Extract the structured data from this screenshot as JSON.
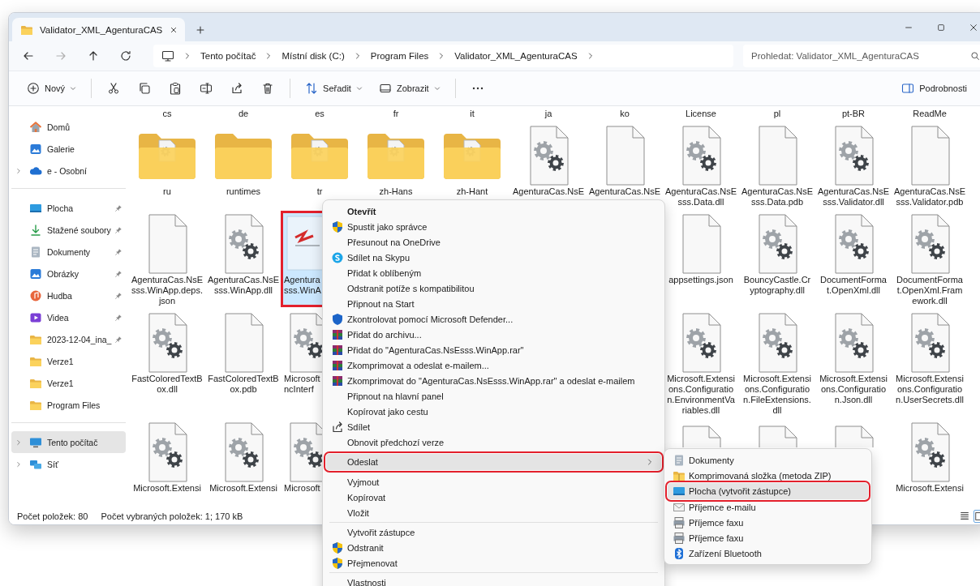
{
  "window": {
    "title": "Validator_XML_AgenturaCAS"
  },
  "nav_buttons": [
    {
      "kind": "back",
      "disabled": false
    },
    {
      "kind": "forward",
      "disabled": true
    },
    {
      "kind": "up",
      "disabled": false
    },
    {
      "kind": "refresh",
      "disabled": false
    }
  ],
  "breadcrumb": [
    "Tento počítač",
    "Místní disk (C:)",
    "Program Files",
    "Validator_XML_AgenturaCAS"
  ],
  "search": {
    "placeholder": "Prohledat: Validator_XML_AgenturaCAS"
  },
  "toolbar": [
    {
      "kind": "new",
      "label": "Nový"
    },
    {
      "kind": "separator"
    },
    {
      "kind": "cut"
    },
    {
      "kind": "copy"
    },
    {
      "kind": "paste"
    },
    {
      "kind": "rename"
    },
    {
      "kind": "share"
    },
    {
      "kind": "delete"
    },
    {
      "kind": "separator"
    },
    {
      "kind": "sort",
      "label": "Seřadit"
    },
    {
      "kind": "view",
      "label": "Zobrazit"
    },
    {
      "kind": "separator"
    },
    {
      "kind": "more"
    }
  ],
  "details_button": {
    "label": "Podrobnosti"
  },
  "sidebar": {
    "groups": [
      {
        "items": [
          {
            "kind": "home",
            "label": "Domů",
            "pinned": false,
            "expandable": false,
            "selected": false
          },
          {
            "kind": "gallery",
            "label": "Galerie",
            "pinned": false,
            "expandable": false,
            "selected": false
          },
          {
            "kind": "cloud",
            "label": "e - Osobní",
            "pinned": false,
            "expandable": true,
            "selected": false
          }
        ]
      },
      {
        "items": [
          {
            "kind": "desktop",
            "label": "Plocha",
            "pinned": true,
            "expandable": false,
            "selected": false
          },
          {
            "kind": "download",
            "label": "Stažené soubory",
            "pinned": true,
            "expandable": false,
            "selected": false
          },
          {
            "kind": "documents",
            "label": "Dokumenty",
            "pinned": true,
            "expandable": false,
            "selected": false
          },
          {
            "kind": "pictures",
            "label": "Obrázky",
            "pinned": true,
            "expandable": false,
            "selected": false
          },
          {
            "kind": "music",
            "label": "Hudba",
            "pinned": true,
            "expandable": false,
            "selected": false
          },
          {
            "kind": "videos",
            "label": "Videa",
            "pinned": true,
            "expandable": false,
            "selected": false
          },
          {
            "kind": "folder",
            "label": "2023-12-04_ina_",
            "pinned": true,
            "expandable": false,
            "selected": false
          },
          {
            "kind": "folder",
            "label": "Verze1",
            "pinned": false,
            "expandable": false,
            "selected": false
          },
          {
            "kind": "folder",
            "label": "Verze1",
            "pinned": false,
            "expandable": false,
            "selected": false
          },
          {
            "kind": "folder",
            "label": "Program Files",
            "pinned": false,
            "expandable": false,
            "selected": false
          }
        ]
      },
      {
        "items": [
          {
            "kind": "pc",
            "label": "Tento počítač",
            "pinned": false,
            "expandable": true,
            "selected": true
          },
          {
            "kind": "network",
            "label": "Síť",
            "pinned": false,
            "expandable": true,
            "selected": false
          }
        ]
      }
    ]
  },
  "files": {
    "rows": [
      {
        "items": [
          {
            "kind": "name",
            "label": "cs",
            "selected": false,
            "highlighted": false,
            "cut": false
          },
          {
            "kind": "name",
            "label": "de",
            "selected": false,
            "highlighted": false,
            "cut": false
          },
          {
            "kind": "name",
            "label": "es",
            "selected": false,
            "highlighted": false,
            "cut": false
          },
          {
            "kind": "name",
            "label": "fr",
            "selected": false,
            "highlighted": false,
            "cut": false
          },
          {
            "kind": "name",
            "label": "it",
            "selected": false,
            "highlighted": false,
            "cut": false
          },
          {
            "kind": "name",
            "label": "ja",
            "selected": false,
            "highlighted": false,
            "cut": false
          },
          {
            "kind": "name",
            "label": "ko",
            "selected": false,
            "highlighted": false,
            "cut": false
          },
          {
            "kind": "name",
            "label": "License",
            "selected": false,
            "highlighted": false,
            "cut": false
          },
          {
            "kind": "name",
            "label": "pl",
            "selected": false,
            "highlighted": false,
            "cut": false
          },
          {
            "kind": "name",
            "label": "pt-BR",
            "selected": false,
            "highlighted": false,
            "cut": false
          },
          {
            "kind": "name",
            "label": "ReadMe",
            "selected": false,
            "highlighted": false,
            "cut": false
          }
        ]
      },
      {
        "items": [
          {
            "kind": "folder-doc",
            "label": "ru",
            "selected": false,
            "highlighted": false,
            "cut": false
          },
          {
            "kind": "folder",
            "label": "runtimes",
            "selected": false,
            "highlighted": false,
            "cut": false
          },
          {
            "kind": "folder-doc",
            "label": "tr",
            "selected": false,
            "highlighted": false,
            "cut": false
          },
          {
            "kind": "folder-doc",
            "label": "zh-Hans",
            "selected": false,
            "highlighted": false,
            "cut": false
          },
          {
            "kind": "folder-doc",
            "label": "zh-Hant",
            "selected": false,
            "highlighted": false,
            "cut": false
          },
          {
            "kind": "gear-file",
            "label": "AgenturaCas.NsE",
            "selected": false,
            "highlighted": false,
            "cut": false
          },
          {
            "kind": "file",
            "label": "AgenturaCas.NsE",
            "selected": false,
            "highlighted": false,
            "cut": false
          },
          {
            "kind": "gear-file",
            "label": "AgenturaCas.NsE\nsss.Data.dll",
            "selected": false,
            "highlighted": false,
            "cut": false
          },
          {
            "kind": "file",
            "label": "AgenturaCas.NsE\nsss.Data.pdb",
            "selected": false,
            "highlighted": false,
            "cut": false
          },
          {
            "kind": "gear-file",
            "label": "AgenturaCas.NsE\nsss.Validator.dll",
            "selected": false,
            "highlighted": false,
            "cut": false
          },
          {
            "kind": "file",
            "label": "AgenturaCas.NsE\nsss.Validator.pdb",
            "selected": false,
            "highlighted": false,
            "cut": false
          }
        ]
      },
      {
        "items": [
          {
            "kind": "file",
            "label": "AgenturaCas.NsE\nsss.WinApp.deps.\njson",
            "selected": false,
            "highlighted": false,
            "cut": false
          },
          {
            "kind": "gear-file",
            "label": "AgenturaCas.NsE\nsss.WinApp.dll",
            "selected": false,
            "highlighted": false,
            "cut": false
          },
          {
            "kind": "app",
            "label": "Agentura\nsss.WinA",
            "selected": true,
            "highlighted": true,
            "cut": true
          },
          {
            "kind": "hidden"
          },
          {
            "kind": "hidden"
          },
          {
            "kind": "hidden"
          },
          {
            "kind": "hidden"
          },
          {
            "kind": "file",
            "label": "appsettings.json",
            "selected": false,
            "highlighted": false,
            "cut": false
          },
          {
            "kind": "gear-file",
            "label": "BouncyCastle.Cr\nyptography.dll",
            "selected": false,
            "highlighted": false,
            "cut": false
          },
          {
            "kind": "gear-file",
            "label": "DocumentForma\nt.OpenXml.dll",
            "selected": false,
            "highlighted": false,
            "cut": false
          },
          {
            "kind": "gear-file",
            "label": "DocumentForma\nt.OpenXml.Fram\nework.dll",
            "selected": false,
            "highlighted": false,
            "cut": false
          }
        ]
      },
      {
        "items": [
          {
            "kind": "gear-file",
            "label": "FastColoredTextB\nox.dll",
            "selected": false,
            "highlighted": false,
            "cut": false
          },
          {
            "kind": "file",
            "label": "FastColoredTextB\nox.pdb",
            "selected": false,
            "highlighted": false,
            "cut": false
          },
          {
            "kind": "gear-file",
            "label": "Microsoft\nncInterf",
            "selected": false,
            "highlighted": false,
            "cut": true
          },
          {
            "kind": "hidden"
          },
          {
            "kind": "hidden"
          },
          {
            "kind": "hidden"
          },
          {
            "kind": "hidden"
          },
          {
            "kind": "gear-file",
            "label": "Microsoft.Extensi\nons.Configuratio\nn.EnvironmentVa\nriables.dll",
            "selected": false,
            "highlighted": false,
            "cut": false
          },
          {
            "kind": "gear-file",
            "label": "Microsoft.Extensi\nons.Configuratio\nn.FileExtensions.\ndll",
            "selected": false,
            "highlighted": false,
            "cut": false
          },
          {
            "kind": "gear-file",
            "label": "Microsoft.Extensi\nons.Configuratio\nn.Json.dll",
            "selected": false,
            "highlighted": false,
            "cut": false
          },
          {
            "kind": "gear-file",
            "label": "Microsoft.Extensi\nons.Configuratio\nn.UserSecrets.dll",
            "selected": false,
            "highlighted": false,
            "cut": false
          }
        ]
      },
      {
        "items": [
          {
            "kind": "gear-file",
            "label": "Microsoft.Extensi",
            "selected": false,
            "highlighted": false,
            "cut": false
          },
          {
            "kind": "gear-file",
            "label": "Microsoft.Extensi",
            "selected": false,
            "highlighted": false,
            "cut": false
          },
          {
            "kind": "gear-file",
            "label": "Microsoft",
            "selected": false,
            "highlighted": false,
            "cut": true
          },
          {
            "kind": "hidden"
          },
          {
            "kind": "hidden"
          },
          {
            "kind": "hidden"
          },
          {
            "kind": "hidden"
          },
          {
            "kind": "file-top",
            "selected": false,
            "highlighted": false,
            "cut": false
          },
          {
            "kind": "file-top",
            "selected": false,
            "highlighted": false,
            "cut": false
          },
          {
            "kind": "file-top",
            "selected": false,
            "highlighted": false,
            "cut": false
          },
          {
            "kind": "gear-file",
            "label": "Microsoft.Extensi",
            "selected": false,
            "highlighted": false,
            "cut": false
          }
        ]
      }
    ]
  },
  "status_bar": {
    "item_count": "Počet položek: 80",
    "selection": "Počet vybraných položek: 1; 170 kB"
  },
  "context_menu": {
    "items": [
      {
        "kind": "plain",
        "label": "Otevřít",
        "default": true,
        "hovered": false,
        "highlighted": false
      },
      {
        "kind": "shield",
        "label": "Spustit jako správce",
        "default": false,
        "hovered": false,
        "highlighted": false
      },
      {
        "kind": "plain",
        "label": "Přesunout na OneDrive",
        "default": false,
        "hovered": false,
        "highlighted": false
      },
      {
        "kind": "skype",
        "label": "Sdílet na Skypu",
        "default": false,
        "hovered": false,
        "highlighted": false
      },
      {
        "kind": "plain",
        "label": "Přidat k oblíbeným",
        "default": false,
        "hovered": false,
        "highlighted": false
      },
      {
        "kind": "plain",
        "label": "Odstranit potíže s kompatibilitou",
        "default": false,
        "hovered": false,
        "highlighted": false
      },
      {
        "kind": "plain",
        "label": "Připnout na Start",
        "default": false,
        "hovered": false,
        "highlighted": false
      },
      {
        "kind": "defender",
        "label": "Zkontrolovat pomocí Microsoft Defender...",
        "default": false,
        "hovered": false,
        "highlighted": false
      },
      {
        "kind": "winrar",
        "label": "Přidat do archivu...",
        "default": false,
        "hovered": false,
        "highlighted": false
      },
      {
        "kind": "winrar",
        "label": "Přidat do \"AgenturaCas.NsEsss.WinApp.rar\"",
        "default": false,
        "hovered": false,
        "highlighted": false
      },
      {
        "kind": "winrar",
        "label": "Zkomprimovat a odeslat e-mailem...",
        "default": false,
        "hovered": false,
        "highlighted": false
      },
      {
        "kind": "winrar",
        "label": "Zkomprimovat do \"AgenturaCas.NsEsss.WinApp.rar\" a odeslat e-mailem",
        "default": false,
        "hovered": false,
        "highlighted": false
      },
      {
        "kind": "plain",
        "label": "Připnout na hlavní panel",
        "default": false,
        "hovered": false,
        "highlighted": false
      },
      {
        "kind": "plain",
        "label": "Kopírovat jako cestu",
        "default": false,
        "hovered": false,
        "highlighted": false
      },
      {
        "kind": "share",
        "label": "Sdílet",
        "default": false,
        "hovered": false,
        "highlighted": false
      },
      {
        "kind": "plain",
        "label": "Obnovit předchozí verze",
        "default": false,
        "hovered": false,
        "highlighted": false
      },
      {
        "kind": "separator"
      },
      {
        "kind": "submenu",
        "label": "Odeslat",
        "default": false,
        "hovered": true,
        "highlighted": true
      },
      {
        "kind": "separator"
      },
      {
        "kind": "plain",
        "label": "Vyjmout",
        "default": false,
        "hovered": false,
        "highlighted": false
      },
      {
        "kind": "plain",
        "label": "Kopírovat",
        "default": false,
        "hovered": false,
        "highlighted": false
      },
      {
        "kind": "plain",
        "label": "Vložit",
        "default": false,
        "hovered": false,
        "highlighted": false
      },
      {
        "kind": "separator"
      },
      {
        "kind": "plain",
        "label": "Vytvořit zástupce",
        "default": false,
        "hovered": false,
        "highlighted": false
      },
      {
        "kind": "shield",
        "label": "Odstranit",
        "default": false,
        "hovered": false,
        "highlighted": false
      },
      {
        "kind": "shield",
        "label": "Přejmenovat",
        "default": false,
        "hovered": false,
        "highlighted": false
      },
      {
        "kind": "separator"
      },
      {
        "kind": "plain",
        "label": "Vlastnosti",
        "default": false,
        "hovered": false,
        "highlighted": false
      }
    ]
  },
  "submenu": {
    "items": [
      {
        "kind": "documents",
        "label": "Dokumenty",
        "hovered": false,
        "highlighted": false
      },
      {
        "kind": "zip",
        "label": "Komprimovaná složka (metoda ZIP)",
        "hovered": false,
        "highlighted": false
      },
      {
        "kind": "desktop",
        "label": "Plocha (vytvořit zástupce)",
        "hovered": true,
        "highlighted": true
      },
      {
        "kind": "mail",
        "label": "Příjemce e-mailu",
        "hovered": false,
        "highlighted": false
      },
      {
        "kind": "fax",
        "label": "Příjemce faxu",
        "hovered": false,
        "highlighted": false
      },
      {
        "kind": "fax",
        "label": "Příjemce faxu",
        "hovered": false,
        "highlighted": false
      },
      {
        "kind": "bluetooth",
        "label": "Zařízení Bluetooth",
        "hovered": false,
        "highlighted": false
      }
    ]
  }
}
